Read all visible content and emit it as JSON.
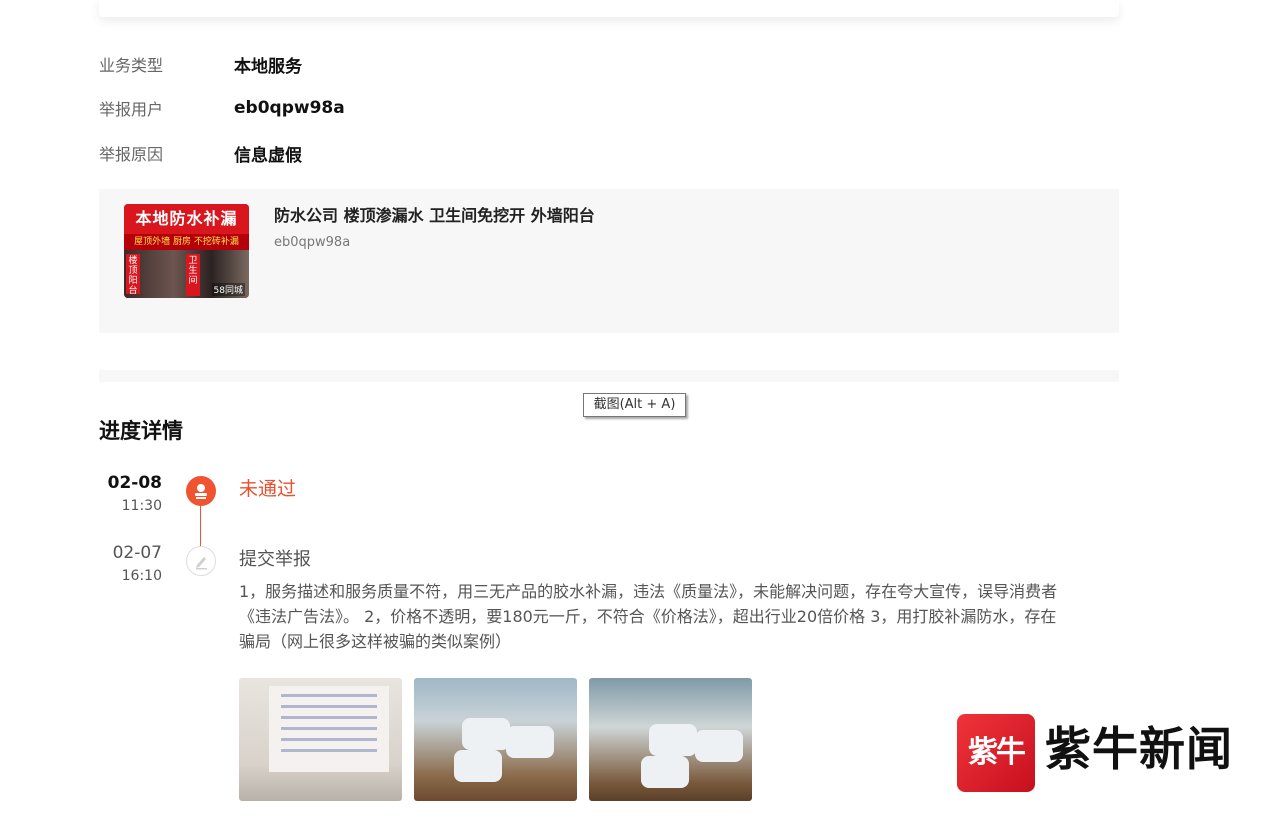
{
  "info": {
    "business_type_label": "业务类型",
    "business_type_value": "本地服务",
    "reporter_label": "举报用户",
    "reporter_value": "eb0qpw98a",
    "reason_label": "举报原因",
    "reason_value": "信息虚假"
  },
  "service_card": {
    "title": "防水公司 楼顶渗漏水 卫生间免挖开 外墙阳台",
    "user": "eb0qpw98a",
    "thumb_headline": "本地防水补漏",
    "thumb_subline": "屋顶外墙 厨房 不挖砖补漏",
    "thumb_left_label": "楼顶阳台",
    "thumb_right_label": "卫生间",
    "thumb_tag": "58同城"
  },
  "tooltip": "截图(Alt + A)",
  "progress": {
    "title": "进度详情",
    "items": [
      {
        "date": "02-08",
        "time": "11:30",
        "status": "未通过"
      },
      {
        "date": "02-07",
        "time": "16:10",
        "status": "提交举报"
      }
    ],
    "description": "1，服务描述和服务质量不符，用三无产品的胶水补漏，违法《质量法》，未能解决问题，存在夸大宣传，误导消费者《违法广告法》。 2，价格不透明，要180元一斤，不符合《价格法》，超出行业20倍价格 3，用打胶补漏防水，存在骗局（网上很多这样被骗的类似案例）"
  },
  "watermark": {
    "icon_text": "紫牛",
    "brand_text": "紫牛新闻"
  },
  "colors": {
    "accent_red": "#e8502e",
    "brand_red": "#d9161d"
  }
}
